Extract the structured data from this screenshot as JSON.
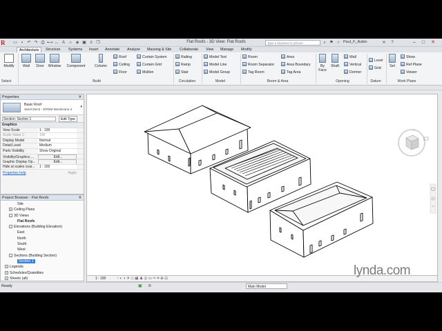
{
  "titlebar": {
    "app_logo": "R",
    "doc_title": "Flat Roofs - 3D View: Flat Roofs",
    "search_placeholder": "Type a keyword or phrase",
    "user": "Paul_F_Aubin"
  },
  "tabs": [
    "Architecture",
    "Structure",
    "Systems",
    "Insert",
    "Annotate",
    "Analyze",
    "Massing & Site",
    "Collaborate",
    "View",
    "Manage",
    "Modify"
  ],
  "ribbon": {
    "select": {
      "modify": "Modify",
      "label": "Select"
    },
    "build": {
      "big": [
        "Wall",
        "Door",
        "Window",
        "Component",
        "Column"
      ],
      "small_col1": [
        "Roof",
        "Ceiling",
        "Floor"
      ],
      "small_col2": [
        "Curtain System",
        "Curtain Grid",
        "Mullion"
      ],
      "label": "Build"
    },
    "circulation": {
      "items": [
        "Railing",
        "Ramp",
        "Stair"
      ],
      "label": "Circulation"
    },
    "model": {
      "items": [
        "Model Text",
        "Model Line",
        "Model Group"
      ],
      "label": "Model"
    },
    "room_area": {
      "col1": [
        "Room",
        "Room Separator",
        "Tag Room"
      ],
      "col2": [
        "Area",
        "Area Boundary",
        "Tag Area"
      ],
      "label": "Room & Area"
    },
    "opening": {
      "big": [
        "By Face",
        "Shaft"
      ],
      "small": [
        "Wall",
        "Vertical",
        "Dormer"
      ],
      "label": "Opening"
    },
    "datum": {
      "items": [
        "Level",
        "Grid"
      ],
      "label": "Datum"
    },
    "work_plane": {
      "set": "Set",
      "items": [
        "Show",
        "Ref Plane",
        "Viewer"
      ],
      "label": "Work Plane"
    }
  },
  "properties": {
    "header": "Properties",
    "type_name": "Basic Roof",
    "type_sub": "Steel Deck - EPDM Membrane 2",
    "instance": "Section: Section 1",
    "edit_type": "Edit Type",
    "group": "Graphics",
    "rows": [
      {
        "k": "View Scale",
        "v": "1 : 100"
      },
      {
        "k": "Scale Value  1:",
        "v": "100"
      },
      {
        "k": "Display Model",
        "v": "Normal"
      },
      {
        "k": "Detail Level",
        "v": "Medium"
      },
      {
        "k": "Parts Visibility",
        "v": "Show Original"
      },
      {
        "k": "Visibility/Graphics ...",
        "v": "Edit..."
      },
      {
        "k": "Graphic Display Op...",
        "v": "Edit..."
      },
      {
        "k": "Hide at scales coar...",
        "v": "1 : 100"
      }
    ],
    "help": "Properties help",
    "apply": "Apply"
  },
  "browser": {
    "header": "Project Browser - Flat Roofs",
    "items": [
      {
        "label": "Site",
        "indent": 3,
        "toggle": ""
      },
      {
        "label": "Ceiling Plans",
        "indent": 1,
        "toggle": "+"
      },
      {
        "label": "3D Views",
        "indent": 1,
        "toggle": "-"
      },
      {
        "label": "Flat Roofs",
        "indent": 3,
        "toggle": "",
        "bold": true
      },
      {
        "label": "Elevations (Building Elevation)",
        "indent": 1,
        "toggle": "-"
      },
      {
        "label": "East",
        "indent": 3,
        "toggle": ""
      },
      {
        "label": "North",
        "indent": 3,
        "toggle": ""
      },
      {
        "label": "South",
        "indent": 3,
        "toggle": ""
      },
      {
        "label": "West",
        "indent": 3,
        "toggle": ""
      },
      {
        "label": "Sections (Building Section)",
        "indent": 1,
        "toggle": "-"
      },
      {
        "label": "Section 1",
        "indent": 3,
        "toggle": "",
        "selected": true
      },
      {
        "label": "Legends",
        "indent": 0,
        "toggle": "+"
      },
      {
        "label": "Schedules/Quantities",
        "indent": 0,
        "toggle": "+"
      },
      {
        "label": "Sheets (all)",
        "indent": 0,
        "toggle": "+"
      }
    ]
  },
  "view_bar": {
    "scale": "1 : 100"
  },
  "status": {
    "text": "Ready",
    "model": "Main Model",
    "zero": ":0"
  },
  "watermark": "lynda.com",
  "icons": [
    "search-icon",
    "viewcube-icon",
    "navigation-wheel-icon",
    "zoom-icon",
    "close-icon"
  ]
}
